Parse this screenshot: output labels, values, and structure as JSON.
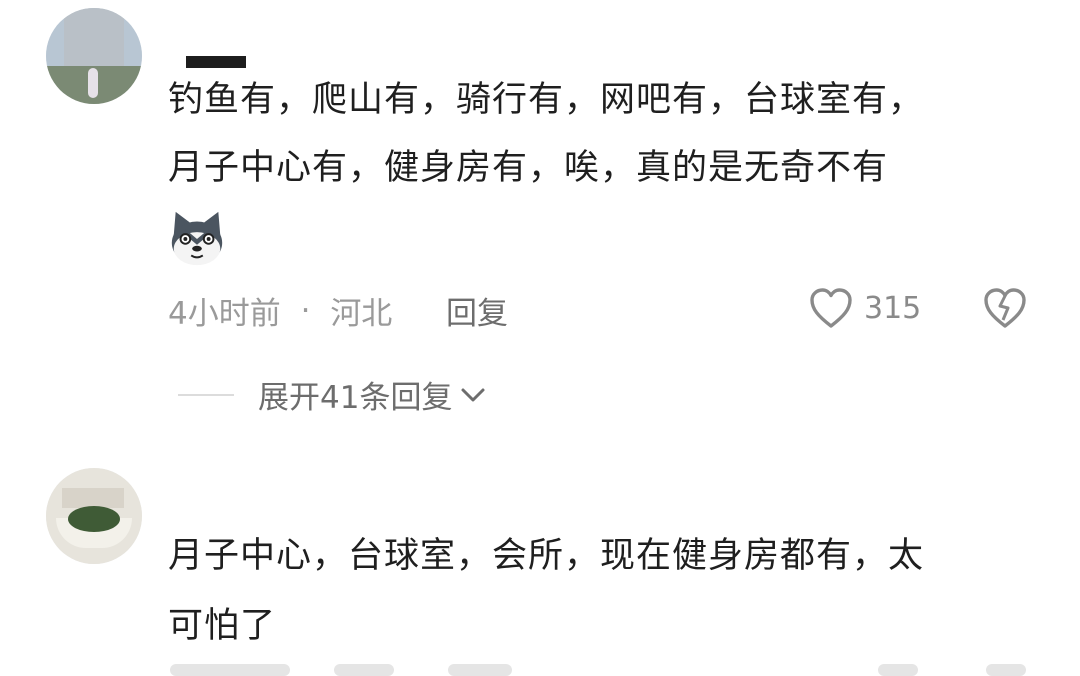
{
  "comments": [
    {
      "text_lines": [
        "钓鱼有，爬山有，骑行有，网吧有，台球室有，",
        "月子中心有，健身房有，唉，真的是无奇不有"
      ],
      "time": "4小时前",
      "dot": "·",
      "location": "河北",
      "reply_label": "回复",
      "likes": "315",
      "expand_label": "展开41条回复"
    },
    {
      "text_lines": [
        "月子中心，台球室，会所，现在健身房都有，太",
        "可怕了"
      ]
    }
  ],
  "icons": {
    "like": "heart-outline-icon",
    "dislike": "broken-heart-icon",
    "expand": "chevron-down-icon",
    "emoji": "dog-face-emoji-icon"
  },
  "colors": {
    "text": "#1f1f1f",
    "meta": "#9a9a9a",
    "secondary": "#6d6d6d",
    "icon": "#8a8a8a"
  }
}
